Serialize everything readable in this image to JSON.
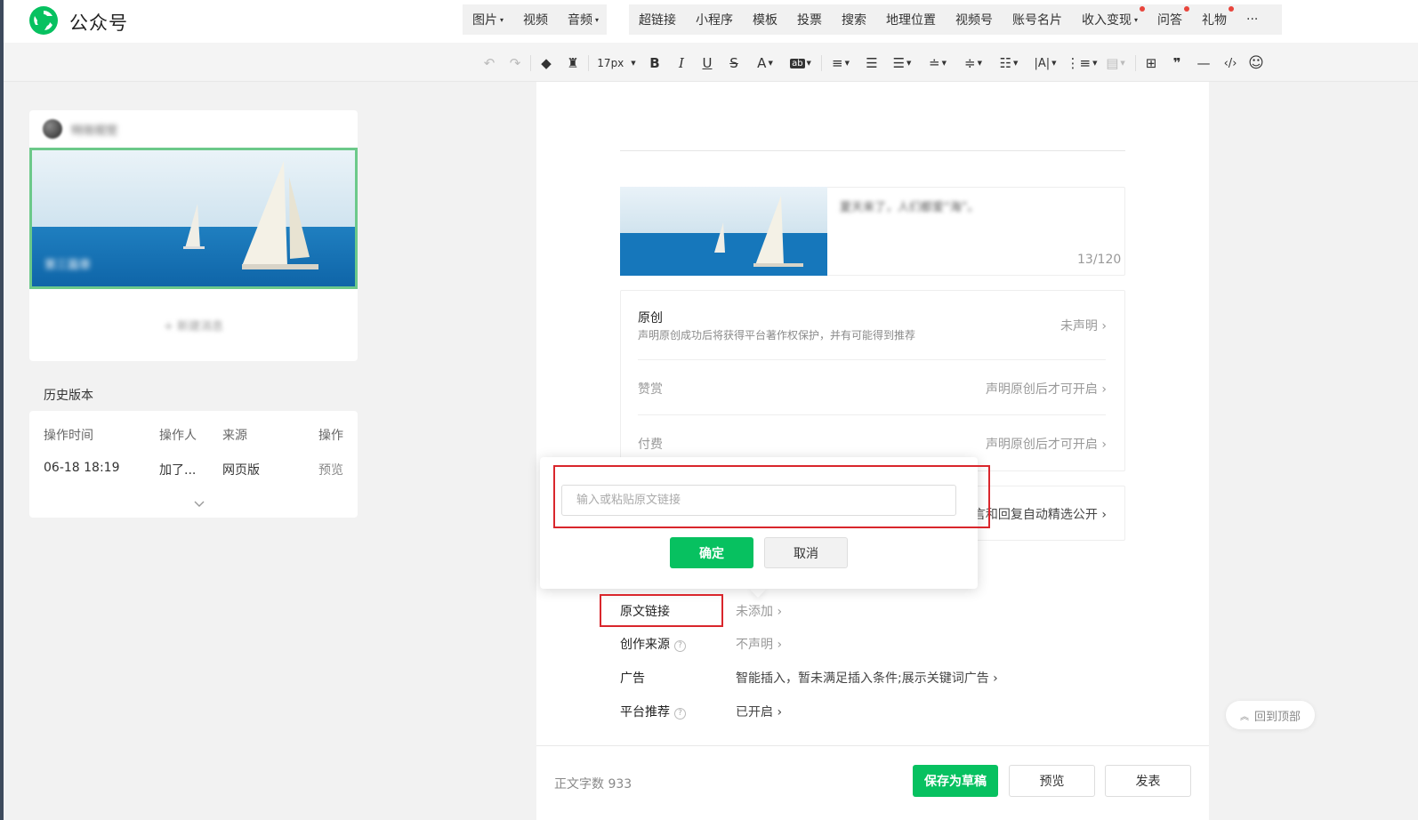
{
  "app": {
    "brand": "公众号"
  },
  "nav": {
    "group1": [
      {
        "label": "图片",
        "caret": true
      },
      {
        "label": "视频",
        "caret": false
      },
      {
        "label": "音频",
        "caret": true
      }
    ],
    "group2": [
      {
        "label": "超链接",
        "caret": false,
        "dot": false
      },
      {
        "label": "小程序",
        "caret": false,
        "dot": false
      },
      {
        "label": "模板",
        "caret": false,
        "dot": false
      },
      {
        "label": "投票",
        "caret": false,
        "dot": false
      },
      {
        "label": "搜索",
        "caret": false,
        "dot": false
      },
      {
        "label": "地理位置",
        "caret": false,
        "dot": false
      },
      {
        "label": "视频号",
        "caret": false,
        "dot": false
      },
      {
        "label": "账号名片",
        "caret": false,
        "dot": false
      },
      {
        "label": "收入变现",
        "caret": true,
        "dot": true
      },
      {
        "label": "问答",
        "caret": false,
        "dot": true
      },
      {
        "label": "礼物",
        "caret": false,
        "dot": true
      },
      {
        "label": "···",
        "caret": false,
        "dot": false
      }
    ]
  },
  "toolbar": {
    "font_size": "17px"
  },
  "sidebar": {
    "account_name": "特效视觉",
    "cover_caption": "第三篇章",
    "add_article": "+ 新建消息",
    "history_title": "历史版本",
    "history_headers": [
      "操作时间",
      "操作人",
      "来源",
      "操作"
    ],
    "history_rows": [
      {
        "time": "06-18 18:19",
        "operator": "加了...",
        "source": "网页版",
        "action": "预览"
      }
    ]
  },
  "digest": {
    "text": "夏天来了，人们都爱“海”。",
    "count": "13/120"
  },
  "settings": {
    "original": {
      "title": "原创",
      "subtitle": "声明原创成功后将获得平台著作权保护，并有可能得到推荐",
      "value": "未声明 ›"
    },
    "reward": {
      "title": "赞赏",
      "value": "声明原创后才可开启 ›"
    },
    "paid": {
      "title": "付费",
      "value": "声明原创后才可开启 ›"
    },
    "comments_value": "言和回复自动精选公开 ›"
  },
  "rows": {
    "source_link": {
      "label": "原文链接",
      "value": "未添加 ›"
    },
    "creation_source": {
      "label": "创作来源",
      "value": "不声明 ›"
    },
    "ads": {
      "label": "广告",
      "value": "智能插入，暂未满足插入条件;展示关键词广告 ›"
    },
    "platform": {
      "label": "平台推荐",
      "value": "已开启 ›"
    }
  },
  "popover": {
    "placeholder": "输入或粘贴原文链接",
    "value": "",
    "ok_label": "确定",
    "cancel_label": "取消"
  },
  "footer": {
    "word_count_label": "正文字数",
    "word_count": "933",
    "save_draft": "保存为草稿",
    "preview": "预览",
    "publish": "发表"
  },
  "backtop": "回到顶部",
  "colors": {
    "accent": "#07c160",
    "highlight": "#d9262c",
    "dot": "#e8453c"
  }
}
